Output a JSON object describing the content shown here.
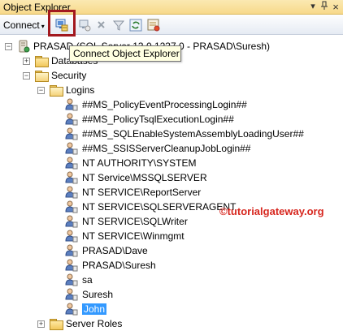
{
  "window": {
    "title": "Object Explorer",
    "pin": "▾ ‹",
    "close": "×"
  },
  "toolbar": {
    "connect_label": "Connect",
    "connect_arrow": "▾",
    "buttons": [
      "connect-object-explorer-icon",
      "disconnect-icon",
      "stop-icon",
      "filter-icon",
      "refresh-icon",
      "activity-monitor-icon"
    ]
  },
  "tooltip": "Connect Object Explorer",
  "tree": {
    "server": {
      "label": "PRASAD (SQL Server 13.0.1237.0 - PRASAD\\Suresh)",
      "toggle": "−"
    },
    "databases": {
      "label": "Databases",
      "toggle": "+"
    },
    "security": {
      "label": "Security",
      "toggle": "−"
    },
    "logins": {
      "label": "Logins",
      "toggle": "−"
    },
    "login_items": [
      "##MS_PolicyEventProcessingLogin##",
      "##MS_PolicyTsqlExecutionLogin##",
      "##MS_SQLEnableSystemAssemblyLoadingUser##",
      "##MS_SSISServerCleanupJobLogin##",
      "NT AUTHORITY\\SYSTEM",
      "NT Service\\MSSQLSERVER",
      "NT SERVICE\\ReportServer",
      "NT SERVICE\\SQLSERVERAGENT",
      "NT SERVICE\\SQLWriter",
      "NT SERVICE\\Winmgmt",
      "PRASAD\\Dave",
      "PRASAD\\Suresh",
      "sa",
      "Suresh",
      "John"
    ],
    "selected_login": "John",
    "server_roles": {
      "label": "Server Roles",
      "toggle": "+"
    }
  },
  "watermark": {
    "symbol": "©",
    "text": "tutorialgateway.org"
  },
  "colors": {
    "title_bar": "#f7d98a",
    "highlight": "#a2181e",
    "selection": "#3399ff",
    "watermark": "#d7261e"
  }
}
